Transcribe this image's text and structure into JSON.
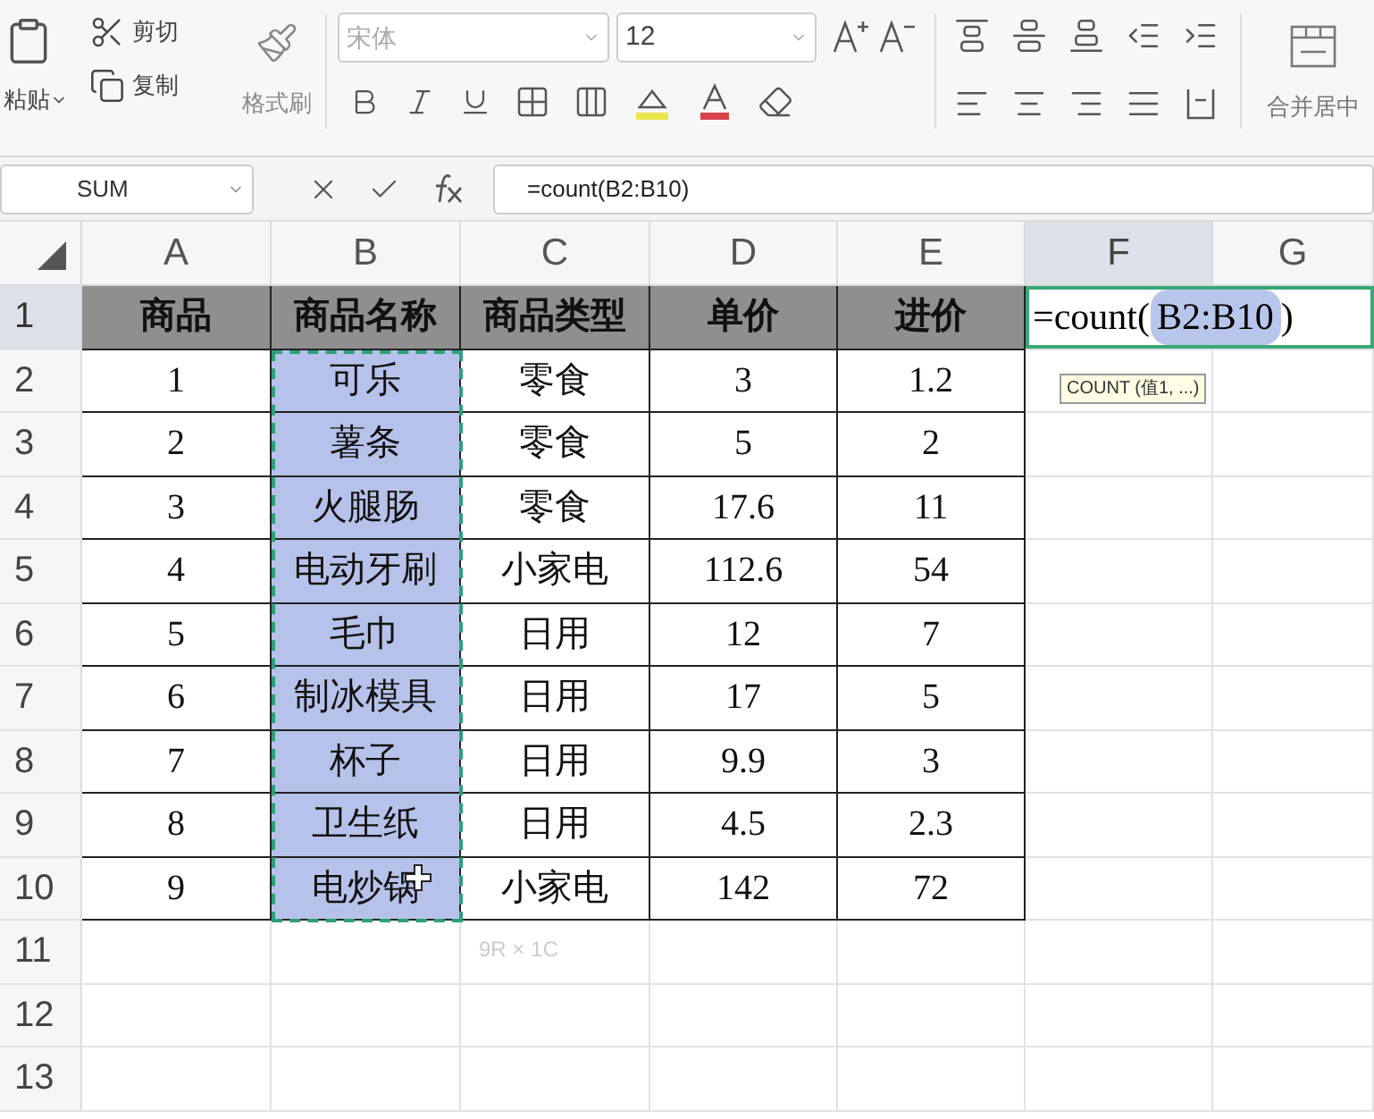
{
  "toolbar": {
    "paste_label": "粘贴",
    "cut_label": "剪切",
    "copy_label": "复制",
    "format_painter_label": "格式刷",
    "font_family": "宋体",
    "font_size": "12",
    "merge_label": "合并居中"
  },
  "formula_bar": {
    "name_box": "SUM",
    "formula": "=count(B2:B10)"
  },
  "columns": [
    {
      "letter": "A",
      "selected": false
    },
    {
      "letter": "B",
      "selected": false
    },
    {
      "letter": "C",
      "selected": false
    },
    {
      "letter": "D",
      "selected": false
    },
    {
      "letter": "E",
      "selected": false
    },
    {
      "letter": "F",
      "selected": true
    },
    {
      "letter": "G",
      "selected": false
    }
  ],
  "rows": [
    {
      "number": "1",
      "selected": true,
      "kind": "header",
      "cells": [
        {
          "text": "商品"
        },
        {
          "text": "商品名称"
        },
        {
          "text": "商品类型"
        },
        {
          "text": "单价"
        },
        {
          "text": "进价"
        }
      ],
      "editor": {
        "prefix": "=count(",
        "reference": "B2:B10",
        "suffix": ")"
      }
    },
    {
      "number": "2",
      "selected": false,
      "kind": "data",
      "cells": [
        {
          "text": "1",
          "highlighted": false
        },
        {
          "text": "可乐",
          "highlighted": true
        },
        {
          "text": "零食",
          "highlighted": false
        },
        {
          "text": "3",
          "highlighted": false
        },
        {
          "text": "1.2",
          "highlighted": false
        }
      ]
    },
    {
      "number": "3",
      "selected": false,
      "kind": "data",
      "cells": [
        {
          "text": "2",
          "highlighted": false
        },
        {
          "text": "薯条",
          "highlighted": true
        },
        {
          "text": "零食",
          "highlighted": false
        },
        {
          "text": "5",
          "highlighted": false
        },
        {
          "text": "2",
          "highlighted": false
        }
      ]
    },
    {
      "number": "4",
      "selected": false,
      "kind": "data",
      "cells": [
        {
          "text": "3",
          "highlighted": false
        },
        {
          "text": "火腿肠",
          "highlighted": true
        },
        {
          "text": "零食",
          "highlighted": false
        },
        {
          "text": "17.6",
          "highlighted": false
        },
        {
          "text": "11",
          "highlighted": false
        }
      ]
    },
    {
      "number": "5",
      "selected": false,
      "kind": "data",
      "cells": [
        {
          "text": "4",
          "highlighted": false
        },
        {
          "text": "电动牙刷",
          "highlighted": true
        },
        {
          "text": "小家电",
          "highlighted": false
        },
        {
          "text": "112.6",
          "highlighted": false
        },
        {
          "text": "54",
          "highlighted": false
        }
      ]
    },
    {
      "number": "6",
      "selected": false,
      "kind": "data",
      "cells": [
        {
          "text": "5",
          "highlighted": false
        },
        {
          "text": "毛巾",
          "highlighted": true
        },
        {
          "text": "日用",
          "highlighted": false
        },
        {
          "text": "12",
          "highlighted": false
        },
        {
          "text": "7",
          "highlighted": false
        }
      ]
    },
    {
      "number": "7",
      "selected": false,
      "kind": "data",
      "cells": [
        {
          "text": "6",
          "highlighted": false
        },
        {
          "text": "制冰模具",
          "highlighted": true
        },
        {
          "text": "日用",
          "highlighted": false
        },
        {
          "text": "17",
          "highlighted": false
        },
        {
          "text": "5",
          "highlighted": false
        }
      ]
    },
    {
      "number": "8",
      "selected": false,
      "kind": "data",
      "cells": [
        {
          "text": "7",
          "highlighted": false
        },
        {
          "text": "杯子",
          "highlighted": true
        },
        {
          "text": "日用",
          "highlighted": false
        },
        {
          "text": "9.9",
          "highlighted": false
        },
        {
          "text": "3",
          "highlighted": false
        }
      ]
    },
    {
      "number": "9",
      "selected": false,
      "kind": "data",
      "cells": [
        {
          "text": "8",
          "highlighted": false
        },
        {
          "text": "卫生纸",
          "highlighted": true
        },
        {
          "text": "日用",
          "highlighted": false
        },
        {
          "text": "4.5",
          "highlighted": false
        },
        {
          "text": "2.3",
          "highlighted": false
        }
      ]
    },
    {
      "number": "10",
      "selected": false,
      "kind": "data",
      "cells": [
        {
          "text": "9",
          "highlighted": false
        },
        {
          "text": "电炒锅",
          "highlighted": true
        },
        {
          "text": "小家电",
          "highlighted": false
        },
        {
          "text": "142",
          "highlighted": false
        },
        {
          "text": "72",
          "highlighted": false
        }
      ]
    },
    {
      "number": "11",
      "selected": false,
      "kind": "empty"
    },
    {
      "number": "12",
      "selected": false,
      "kind": "empty"
    },
    {
      "number": "13",
      "selected": false,
      "kind": "empty"
    }
  ],
  "function_hint": "COUNT (值1, ...)",
  "selection_size": "9R × 1C"
}
